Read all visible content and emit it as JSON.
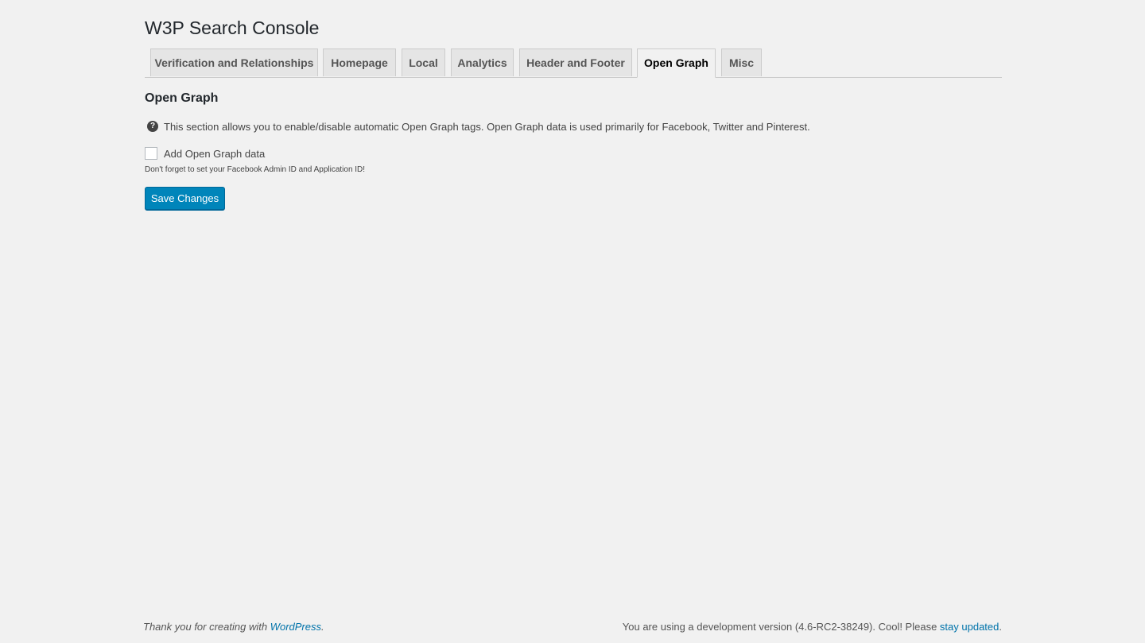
{
  "page": {
    "title": "W3P Search Console"
  },
  "tabs": [
    {
      "label": "Verification and Relationships",
      "active": false
    },
    {
      "label": "Homepage",
      "active": false
    },
    {
      "label": "Local",
      "active": false
    },
    {
      "label": "Analytics",
      "active": false
    },
    {
      "label": "Header and Footer",
      "active": false
    },
    {
      "label": "Open Graph",
      "active": true
    },
    {
      "label": "Misc",
      "active": false
    }
  ],
  "section": {
    "title": "Open Graph",
    "info_icon": "help-icon",
    "info_text": "This section allows you to enable/disable automatic Open Graph tags. Open Graph data is used primarily for Facebook, Twitter and Pinterest.",
    "checkbox_label": "Add Open Graph data",
    "checkbox_checked": false,
    "hint": "Don't forget to set your Facebook Admin ID and Application ID!",
    "save_label": "Save Changes"
  },
  "footer": {
    "left_text": "Thank you for creating with ",
    "left_link": "WordPress",
    "left_suffix": ".",
    "right_text": "You are using a development version (4.6-RC2-38249). Cool! Please ",
    "right_link": "stay updated",
    "right_suffix": "."
  },
  "colors": {
    "background": "#f1f1f1",
    "primary_button": "#0085ba",
    "link": "#0073aa"
  }
}
